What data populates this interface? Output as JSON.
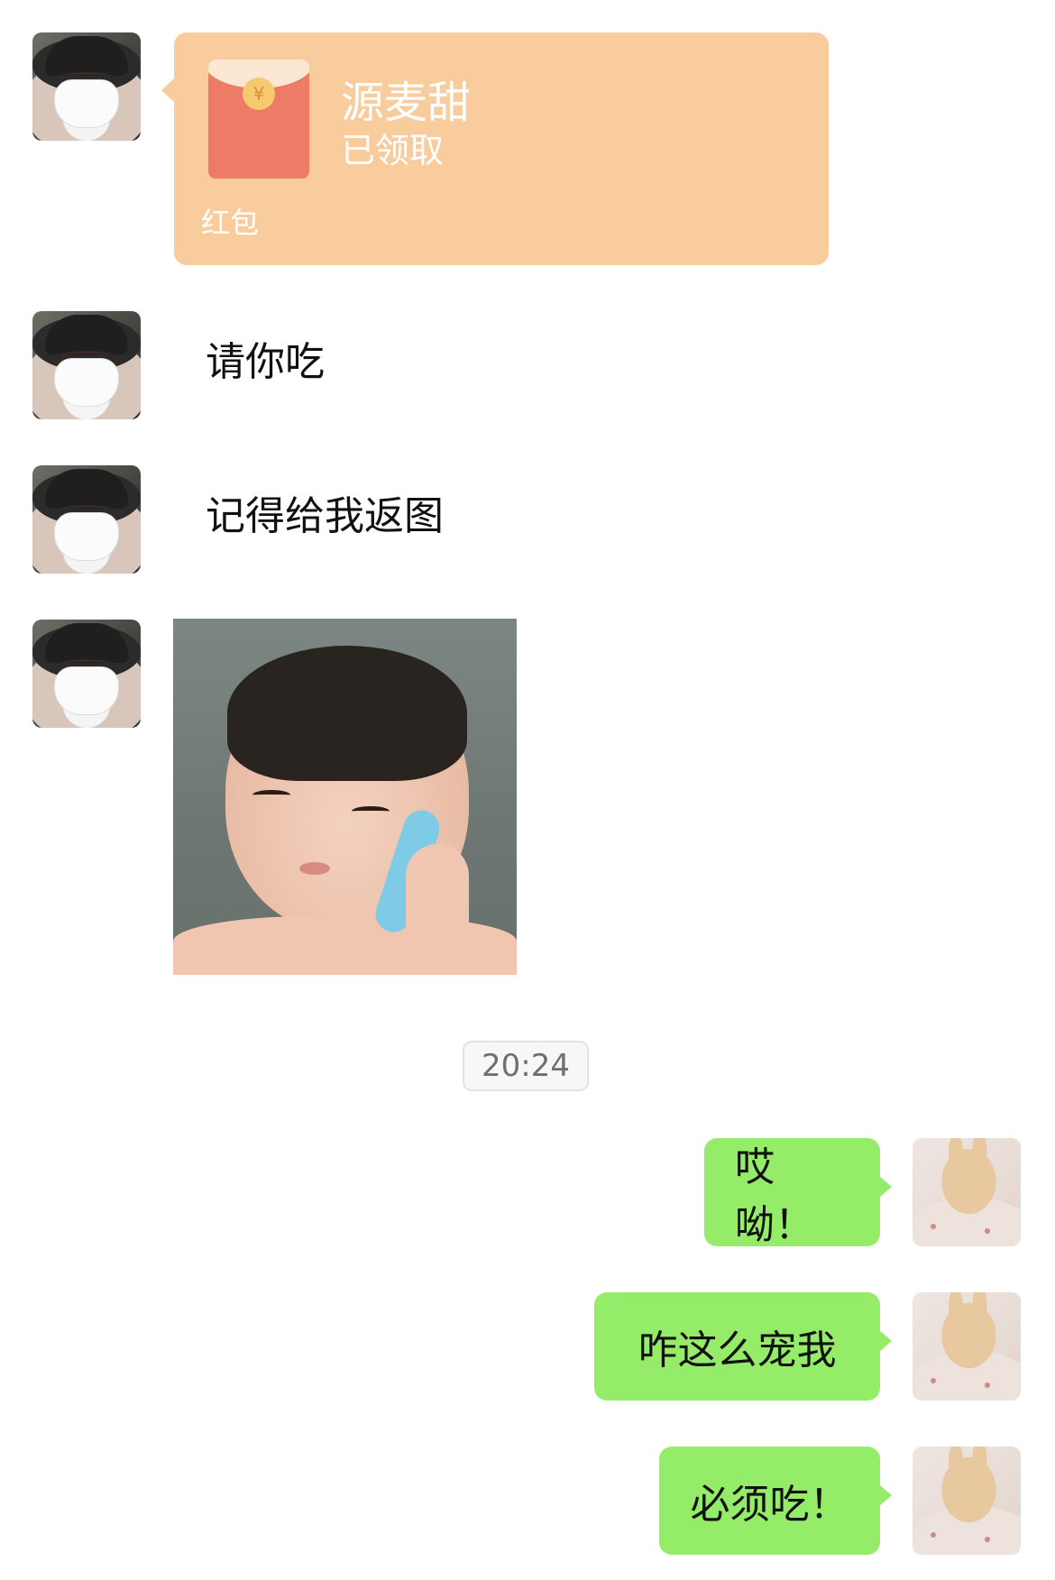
{
  "red_packet": {
    "sender_name": "源麦甜",
    "status": "已领取",
    "label": "红包",
    "coin_symbol": "¥"
  },
  "messages_left": [
    {
      "text": "请你吃"
    },
    {
      "text": "记得给我返图"
    }
  ],
  "timestamp": "20:24",
  "messages_right": [
    {
      "text": "哎呦！"
    },
    {
      "text": "咋这么宠我"
    },
    {
      "text": "必须吃！"
    }
  ],
  "colors": {
    "self_bubble": "#95ec69",
    "red_packet_bg": "#f9cc9d",
    "envelope": "#ed7b65"
  },
  "icons": {
    "left_avatar": "masked-person-avatar",
    "right_avatar": "plush-bunny-avatar",
    "sticker": "baby-on-phone-sticker"
  }
}
